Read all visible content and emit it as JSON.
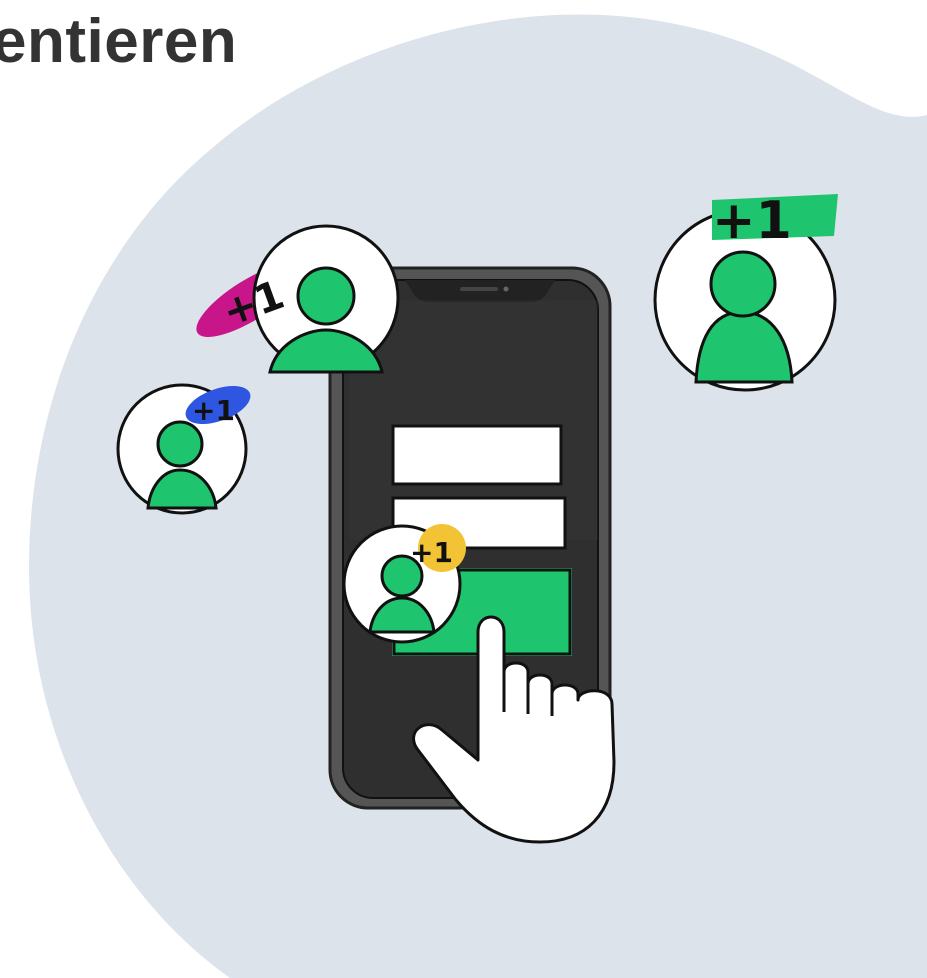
{
  "heading": "entieren",
  "badges": [
    {
      "id": "magenta",
      "label": "+1",
      "color": "#C8168A"
    },
    {
      "id": "blue",
      "label": "+1",
      "color": "#2F56E0"
    },
    {
      "id": "yellow",
      "label": "+1",
      "color": "#F2C335"
    },
    {
      "id": "green",
      "label": "+1",
      "color": "#1FC46E"
    }
  ],
  "colors": {
    "blob": "#DDE3EA",
    "user_green": "#1FC46E",
    "phone_screen": "#2F2F2F",
    "phone_frame": "#4A4A4A",
    "outline": "#111111"
  },
  "icons": [
    "user-icon",
    "pointing-hand-icon",
    "smartphone-icon"
  ]
}
